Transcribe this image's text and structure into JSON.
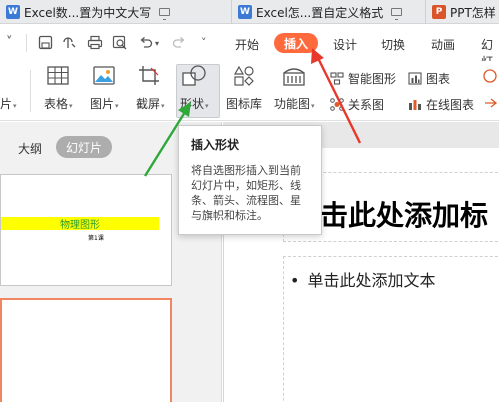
{
  "tabs": [
    {
      "label": "Excel数...置为中文大写",
      "icon": "excel-doc-icon"
    },
    {
      "label": "Excel怎...置自定义格式",
      "icon": "excel-doc-icon"
    },
    {
      "label": "PPT怎样",
      "icon": "ppt-doc-icon"
    }
  ],
  "menu": {
    "items": [
      "开始",
      "插入",
      "设计",
      "切换",
      "动画",
      "幻灯"
    ],
    "active": "插入",
    "active_color": "#ff6a3d"
  },
  "ribbon": {
    "left_partial": "片",
    "table": "表格",
    "picture": "图片",
    "screenshot": "截屏",
    "shape": "形状",
    "icon_lib": "图标库",
    "func_chart": "功能图",
    "smart_art": "智能图形",
    "chart": "图表",
    "relation": "关系图",
    "online_chart": "在线图表"
  },
  "view_tabs": {
    "outline": "大纲",
    "slides": "幻灯片"
  },
  "thumbnail": {
    "title": "物理图形",
    "subtitle": "第1课"
  },
  "slide": {
    "title_placeholder": "击此处添加标",
    "body_placeholder": "单击此处添加文本"
  },
  "tooltip": {
    "title": "插入形状",
    "line1": "将自选图形插入到当前",
    "line2": "幻灯片中，如矩形、线",
    "line3": "条、箭头、流程图、星",
    "line4": "与旗帜和标注。"
  },
  "colors": {
    "annotation_red": "#e8382b",
    "annotation_green": "#2fa83a",
    "ppt_icon": "#d9542b",
    "excel_icon": "#3d7ad6"
  }
}
